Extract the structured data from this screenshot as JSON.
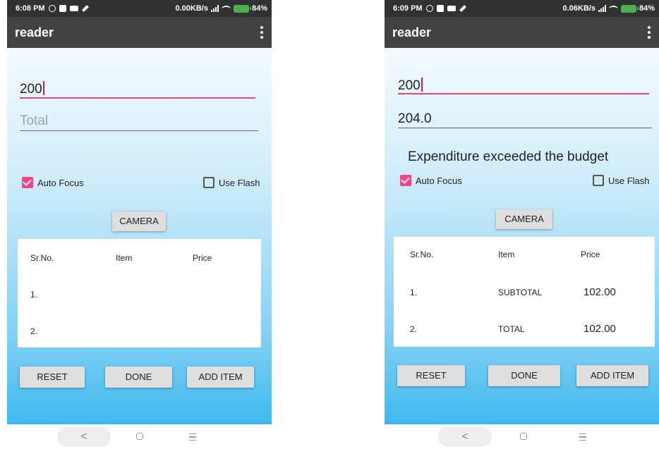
{
  "left": {
    "status": {
      "time": "6:08 PM",
      "speed": "0.00KB/s",
      "battery": "84%"
    },
    "appbar": {
      "title": "reader"
    },
    "budget_field": {
      "value": "200"
    },
    "total_field": {
      "placeholder": "Total"
    },
    "auto_focus": {
      "label": "Auto Focus",
      "checked": true
    },
    "use_flash": {
      "label": "Use Flash",
      "checked": false
    },
    "camera_button": "CAMERA",
    "table": {
      "headers": [
        "Sr.No.",
        "Item",
        "Price"
      ],
      "rows": [
        {
          "sr": "1.",
          "item": "",
          "price": ""
        },
        {
          "sr": "2.",
          "item": "",
          "price": ""
        }
      ]
    },
    "buttons": {
      "reset": "RESET",
      "done": "DONE",
      "add_item": "ADD ITEM"
    },
    "nav": {
      "back": "<"
    }
  },
  "right": {
    "status": {
      "time": "6:09 PM",
      "speed": "0.06KB/s",
      "battery": "84%"
    },
    "appbar": {
      "title": "reader"
    },
    "budget_field": {
      "value": "200"
    },
    "total_field": {
      "value": "204.0"
    },
    "message": "Expenditure exceeded the budget",
    "auto_focus": {
      "label": "Auto Focus",
      "checked": true
    },
    "use_flash": {
      "label": "Use Flash",
      "checked": false
    },
    "camera_button": "CAMERA",
    "table": {
      "headers": [
        "Sr.No.",
        "Item",
        "Price"
      ],
      "rows": [
        {
          "sr": "1.",
          "item": "SUBTOTAL",
          "price": "102.00"
        },
        {
          "sr": "2.",
          "item": "TOTAL",
          "price": "102.00"
        }
      ]
    },
    "buttons": {
      "reset": "RESET",
      "done": "DONE",
      "add_item": "ADD ITEM"
    },
    "nav": {
      "back": "<"
    }
  },
  "colors": {
    "accent": "#ff4081",
    "appbar": "#424242",
    "status_bar": "#323232",
    "underline_active": "#e2457a"
  }
}
